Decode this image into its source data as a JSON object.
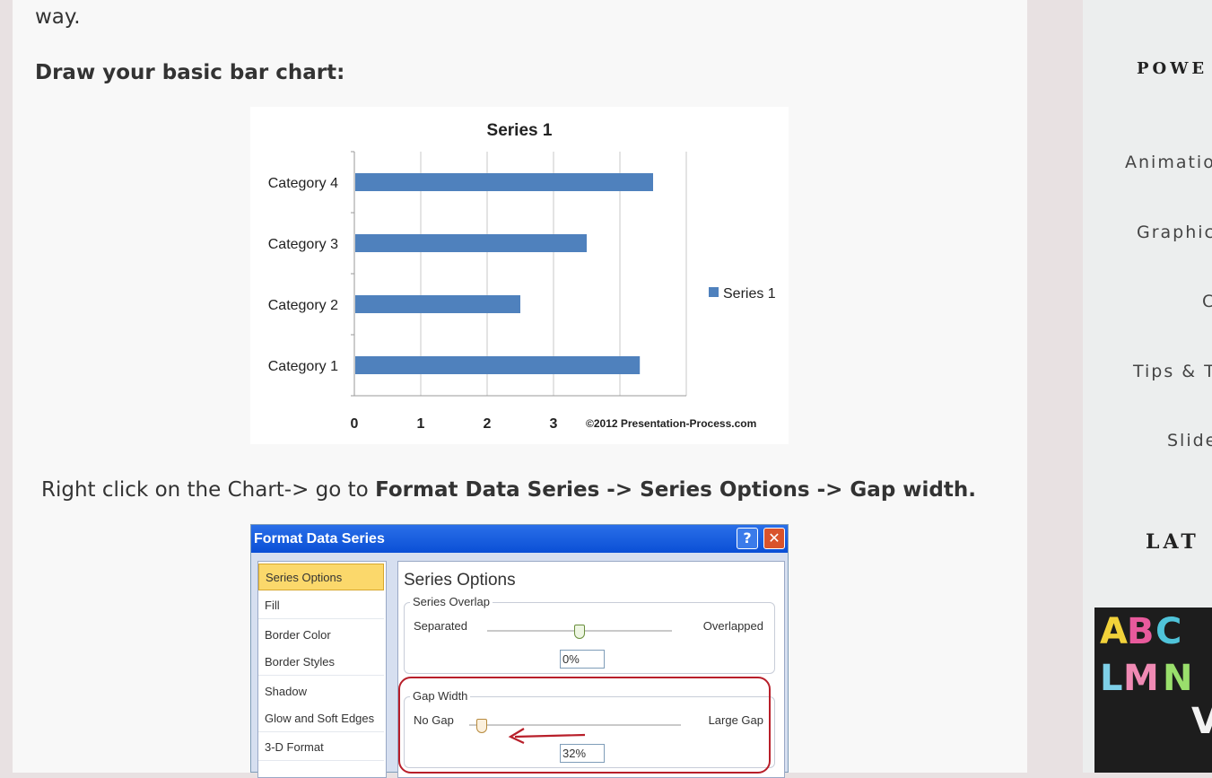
{
  "article": {
    "lead_text": "way.",
    "heading": "Draw your basic bar chart:",
    "instruction_plain": "Right click on the Chart-> go to ",
    "instruction_bold": "Format Data Series -> Series Options -> Gap width."
  },
  "chart_data": {
    "type": "bar",
    "orientation": "horizontal",
    "title": "Series 1",
    "categories": [
      "Category 1",
      "Category 2",
      "Category 3",
      "Category 4"
    ],
    "series": [
      {
        "name": "Series 1",
        "values": [
          4.3,
          2.5,
          3.5,
          4.5
        ]
      }
    ],
    "xlabel": "",
    "ylabel": "",
    "xlim": [
      0,
      5
    ],
    "x_ticks": [
      "0",
      "1",
      "2",
      "3"
    ],
    "grid": true,
    "legend": "right",
    "watermark": "©2012 Presentation-Process.com",
    "colors": {
      "bar": "#4f81bd"
    }
  },
  "dialog": {
    "title": "Format Data Series",
    "help_label": "?",
    "close_label": "✕",
    "categories": [
      "Series Options",
      "Fill",
      "Border Color",
      "Border Styles",
      "Shadow",
      "Glow and Soft Edges",
      "3-D Format"
    ],
    "active_category": "Series Options",
    "panel_title": "Series Options",
    "overlap": {
      "label": "Series Overlap",
      "left_label": "Separated",
      "right_label": "Overlapped",
      "value": "0%",
      "level": 0.5
    },
    "gap": {
      "label": "Gap Width",
      "left_label": "No Gap",
      "right_label": "Large Gap",
      "value": "32%",
      "level": 0.06
    }
  },
  "sidebar": {
    "heading_power": "POWE",
    "links": [
      "Animatio",
      "Graphic",
      "C",
      "Tips & T",
      "Slide"
    ],
    "heading_latest": "LAT"
  },
  "colors": {
    "page_bg": "#e8e1e2",
    "article_bg": "#f8f8f8",
    "sidebar_bg": "#eceeee",
    "highlight": "#b81f2a",
    "titlebar": "#0a4fd6"
  }
}
